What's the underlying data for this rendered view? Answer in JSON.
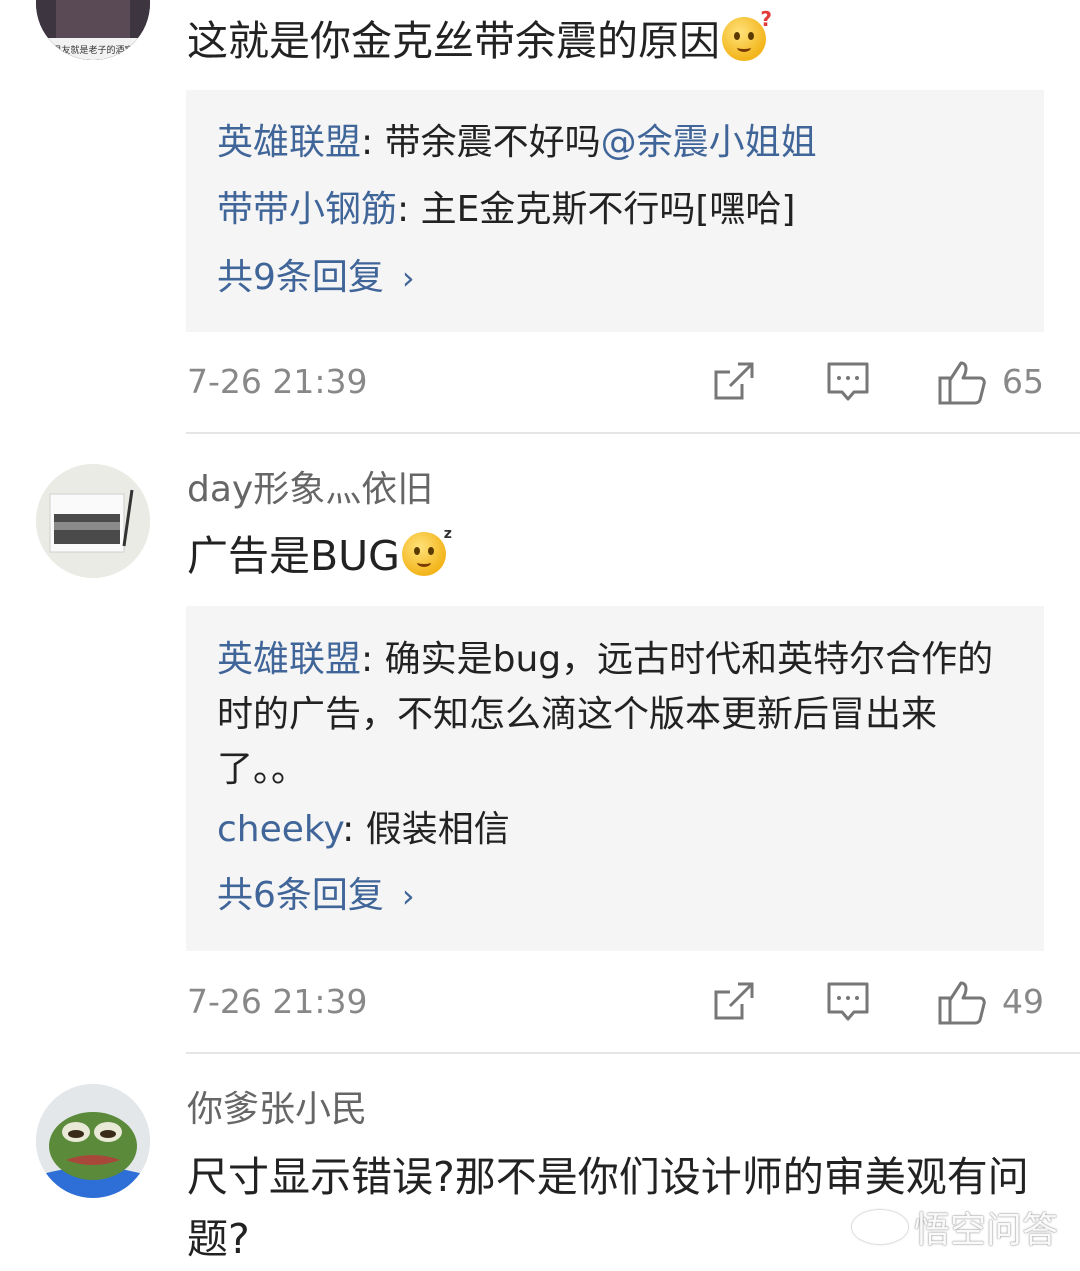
{
  "comments": [
    {
      "username": "",
      "body": "这就是你金克丝带余震的原因",
      "avatar_caption": "男友就是老子的酒窝",
      "replies": [
        {
          "author": "英雄联盟",
          "sep": ": ",
          "text": "带余震不好吗",
          "mention": "@余震小姐姐"
        },
        {
          "author": "带带小钢筋",
          "sep": ": ",
          "text": "主E金克斯不行吗[嘿哈]",
          "mention": ""
        }
      ],
      "more_replies": "共9条回复",
      "time": "7-26 21:39",
      "likes": "65",
      "emoji": "confused-emoji"
    },
    {
      "username": "day形象灬依旧",
      "body": "广告是BUG",
      "replies": [
        {
          "author": "英雄联盟",
          "sep": ": ",
          "text": "确实是bug，远古时代和英特尔合作的时的广告，不知怎么滴这个版本更新后冒出来了。。",
          "mention": ""
        },
        {
          "author": "cheeky",
          "sep": ": ",
          "text": "假装相信",
          "mention": ""
        }
      ],
      "more_replies": "共6条回复",
      "time": "7-26 21:39",
      "likes": "49",
      "emoji": "sweat-emoji"
    },
    {
      "username": "你爹张小民",
      "body": "尺寸显示错误?那不是你们设计师的审美观有问题?"
    }
  ],
  "more_chevron": "›",
  "watermark": "悟空问答",
  "icons": {
    "share": "share-icon",
    "comment": "comment-icon",
    "like": "thumbs-up-icon"
  },
  "colors": {
    "link": "#406599",
    "meta": "#888888",
    "reply_bg": "#f5f5f5"
  }
}
